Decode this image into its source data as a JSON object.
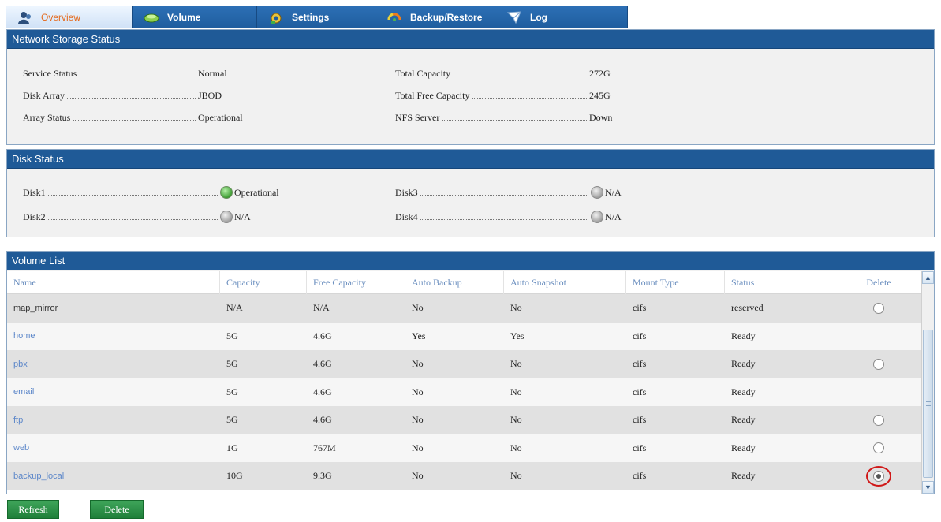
{
  "tabs": [
    {
      "label": "Overview",
      "icon": "user-icon",
      "active": true
    },
    {
      "label": "Volume",
      "icon": "disk-icon",
      "active": false
    },
    {
      "label": "Settings",
      "icon": "settings-icon",
      "active": false
    },
    {
      "label": "Backup/Restore",
      "icon": "backup-icon",
      "active": false
    },
    {
      "label": "Log",
      "icon": "log-icon",
      "active": false
    }
  ],
  "network_storage": {
    "title": "Network Storage Status",
    "service_status": {
      "label": "Service Status",
      "value": "Normal"
    },
    "disk_array": {
      "label": "Disk Array",
      "value": "JBOD"
    },
    "array_status": {
      "label": "Array Status",
      "value": "Operational"
    },
    "total_capacity": {
      "label": "Total Capacity",
      "value": "272G"
    },
    "total_free_capacity": {
      "label": "Total Free Capacity",
      "value": "245G"
    },
    "nfs_server": {
      "label": "NFS Server",
      "value": "Down"
    }
  },
  "disk_status": {
    "title": "Disk Status",
    "disks": [
      {
        "label": "Disk1",
        "value": "Operational",
        "state": "green"
      },
      {
        "label": "Disk2",
        "value": "N/A",
        "state": "grey"
      },
      {
        "label": "Disk3",
        "value": "N/A",
        "state": "grey"
      },
      {
        "label": "Disk4",
        "value": "N/A",
        "state": "grey"
      }
    ]
  },
  "volume_list": {
    "title": "Volume List",
    "columns": [
      "Name",
      "Capacity",
      "Free Capacity",
      "Auto Backup",
      "Auto Snapshot",
      "Mount Type",
      "Status",
      "Delete"
    ],
    "rows": [
      {
        "name": "map_mirror",
        "capacity": "N/A",
        "free": "N/A",
        "auto_backup": "No",
        "auto_snapshot": "No",
        "mount": "cifs",
        "status": "reserved",
        "delete": "unchecked"
      },
      {
        "name": "home",
        "capacity": "5G",
        "free": "4.6G",
        "auto_backup": "Yes",
        "auto_snapshot": "Yes",
        "mount": "cifs",
        "status": "Ready",
        "delete": "none"
      },
      {
        "name": "pbx",
        "capacity": "5G",
        "free": "4.6G",
        "auto_backup": "No",
        "auto_snapshot": "No",
        "mount": "cifs",
        "status": "Ready",
        "delete": "unchecked"
      },
      {
        "name": "email",
        "capacity": "5G",
        "free": "4.6G",
        "auto_backup": "No",
        "auto_snapshot": "No",
        "mount": "cifs",
        "status": "Ready",
        "delete": "none"
      },
      {
        "name": "ftp",
        "capacity": "5G",
        "free": "4.6G",
        "auto_backup": "No",
        "auto_snapshot": "No",
        "mount": "cifs",
        "status": "Ready",
        "delete": "unchecked"
      },
      {
        "name": "web",
        "capacity": "1G",
        "free": "767M",
        "auto_backup": "No",
        "auto_snapshot": "No",
        "mount": "cifs",
        "status": "Ready",
        "delete": "unchecked"
      },
      {
        "name": "backup_local",
        "capacity": "10G",
        "free": "9.3G",
        "auto_backup": "No",
        "auto_snapshot": "No",
        "mount": "cifs",
        "status": "Ready",
        "delete": "checked"
      }
    ]
  },
  "buttons": {
    "refresh": "Refresh",
    "delete": "Delete"
  },
  "colors": {
    "header_blue": "#1f5a97",
    "link_blue": "#5b86c9",
    "button_green": "#2a8f45",
    "highlight_red": "#d01818",
    "active_tab_text": "#e46a1d"
  }
}
